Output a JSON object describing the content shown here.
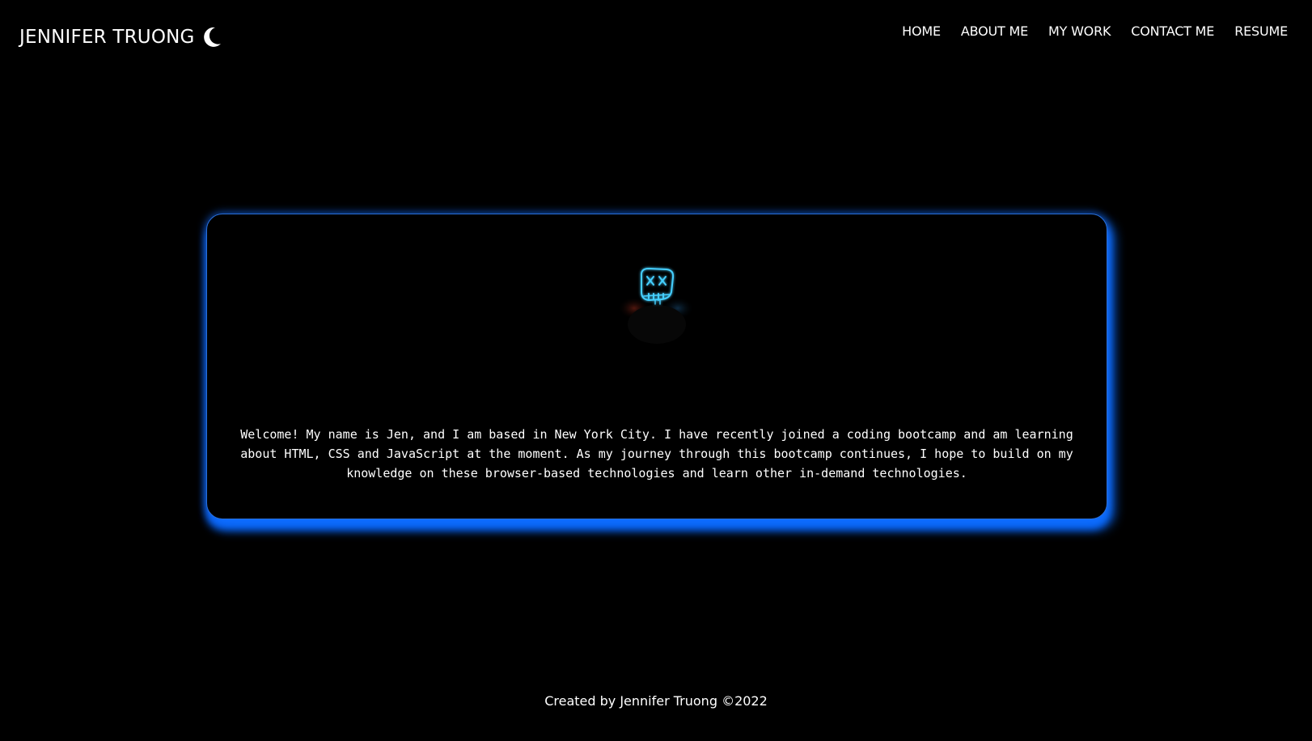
{
  "header": {
    "brand": "JENNIFER TRUONG",
    "theme_icon": "moon-icon"
  },
  "nav": {
    "items": [
      {
        "label": "HOME"
      },
      {
        "label": "ABOUT ME"
      },
      {
        "label": "MY WORK"
      },
      {
        "label": "CONTACT ME"
      },
      {
        "label": "RESUME"
      }
    ]
  },
  "hero": {
    "image_icon": "neon-mask-icon",
    "text": "Welcome! My name is Jen, and I am based in New York City. I have recently joined a coding bootcamp and am learning about HTML, CSS and JavaScript at the moment. As my journey through this bootcamp continues, I hope to build on my knowledge on these browser-based technologies and learn other in-demand technologies."
  },
  "footer": {
    "text": "Created by Jennifer Truong ©2022"
  },
  "colors": {
    "background": "#000000",
    "text": "#ffffff",
    "accent_glow": "#1a7cff",
    "neon": "#3ec8ff"
  }
}
